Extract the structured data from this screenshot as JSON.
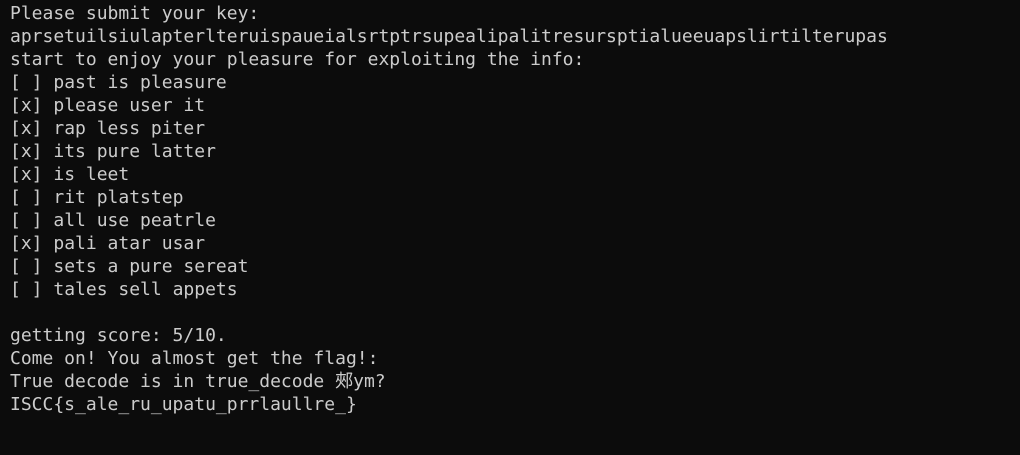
{
  "colors": {
    "background": "#0c0c0c",
    "text": "#cccccc"
  },
  "terminal": {
    "prompt": "Please submit your key:",
    "key": "aprsetuilsiulapterlteruispaueialsrtptrsupealipalitresursptialueeuapslirtilterupas",
    "intro": "start to enjoy your pleasure for exploiting the info:",
    "options": [
      {
        "mark": "[ ]",
        "text": "past is pleasure"
      },
      {
        "mark": "[x]",
        "text": "please user it"
      },
      {
        "mark": "[x]",
        "text": "rap less piter"
      },
      {
        "mark": "[x]",
        "text": "its pure latter"
      },
      {
        "mark": "[x]",
        "text": "is leet"
      },
      {
        "mark": "[ ]",
        "text": "rit platstep"
      },
      {
        "mark": "[ ]",
        "text": "all use peatrle"
      },
      {
        "mark": "[x]",
        "text": "pali atar usar"
      },
      {
        "mark": "[ ]",
        "text": "sets a pure sereat"
      },
      {
        "mark": "[ ]",
        "text": "tales sell appets"
      }
    ],
    "score": "getting score: 5/10.",
    "encourage": "Come on! You almost get the flag!:",
    "decode_hint": "True decode is in true_decode 郟ym?",
    "flag": "ISCC{s_ale_ru_upatu_prrlaullre_}"
  }
}
